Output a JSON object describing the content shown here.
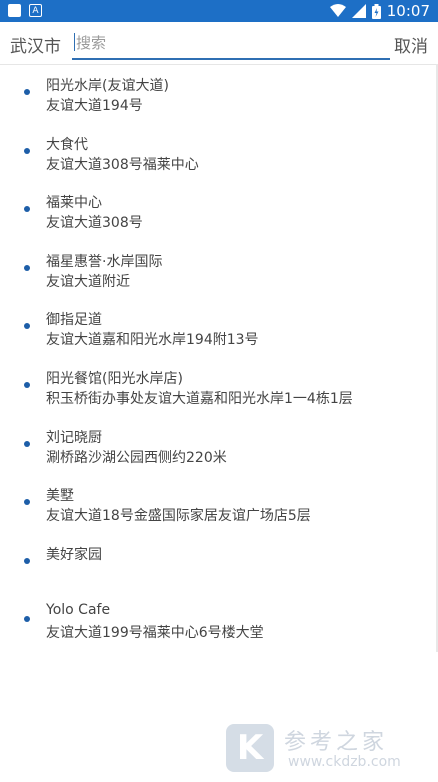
{
  "status_bar": {
    "time": "10:07",
    "left_icons": [
      "notification-icon",
      "a-app-icon"
    ],
    "right_icons": [
      "wifi-icon",
      "signal-icon",
      "battery-icon"
    ]
  },
  "search": {
    "city": "武汉市",
    "placeholder": "搜索",
    "value": "",
    "cancel_label": "取消"
  },
  "results": [
    {
      "name": "阳光水岸(友谊大道)",
      "address": "友谊大道194号"
    },
    {
      "name": "大食代",
      "address": "友谊大道308号福莱中心"
    },
    {
      "name": "福莱中心",
      "address": "友谊大道308号"
    },
    {
      "name": "福星惠誉·水岸国际",
      "address": "友谊大道附近"
    },
    {
      "name": "御指足道",
      "address": "友谊大道嘉和阳光水岸194附13号"
    },
    {
      "name": "阳光餐馆(阳光水岸店)",
      "address": "积玉桥街办事处友谊大道嘉和阳光水岸1一4栋1层"
    },
    {
      "name": "刘记晓厨",
      "address": "涮桥路沙湖公园西侧约220米"
    },
    {
      "name": "美墅",
      "address": "友谊大道18号金盛国际家居友谊广场店5层"
    },
    {
      "name": "美好家园",
      "address": ""
    },
    {
      "name": "Yolo Cafe",
      "address": "友谊大道199号福莱中心6号楼大堂"
    }
  ],
  "watermark": {
    "logo_letter": "K",
    "title": "参考之家",
    "url": "www.ckdzb.com"
  },
  "colors": {
    "status_bar": "#1d6fc6",
    "accent": "#2f6fb3",
    "dot": "#1d5ea8"
  }
}
